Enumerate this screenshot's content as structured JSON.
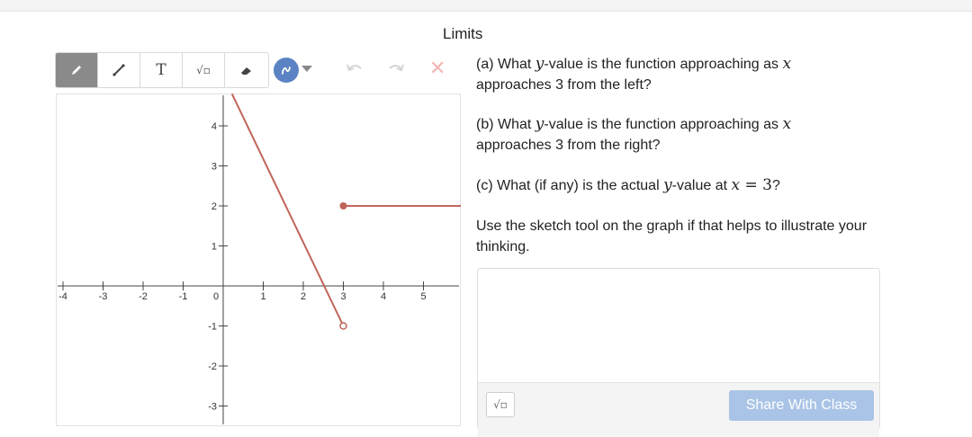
{
  "page": {
    "title": "Limits"
  },
  "toolbar": {
    "tools": [
      {
        "name": "pencil-icon",
        "active": true
      },
      {
        "name": "line-tool-icon",
        "active": false
      },
      {
        "name": "text-tool-icon",
        "label": "T",
        "active": false
      },
      {
        "name": "math-tool-icon",
        "label": "√▫",
        "active": false
      },
      {
        "name": "eraser-icon",
        "active": false
      }
    ],
    "color_button": {
      "color": "#5b83c4",
      "icon": "scribble-icon"
    },
    "undo_icon": "undo-icon",
    "redo_icon": "redo-icon",
    "clear_label": "✕"
  },
  "chart_data": {
    "type": "line",
    "x_ticks": [
      "-4",
      "-3",
      "-2",
      "-1",
      "0",
      "1",
      "2",
      "3",
      "4",
      "5"
    ],
    "y_ticks": [
      "4",
      "3",
      "2",
      "1",
      "-1",
      "-2",
      "-3"
    ],
    "xlim": [
      -4,
      6
    ],
    "ylim": [
      -3.5,
      4.8
    ],
    "series": [
      {
        "points": [
          [
            0.22,
            4.8
          ],
          [
            3,
            -1
          ]
        ],
        "color": "#c0655a",
        "end_marker": "open"
      },
      {
        "points": [
          [
            3,
            2
          ],
          [
            6,
            2
          ]
        ],
        "color": "#c0655a",
        "start_marker": "closed"
      }
    ]
  },
  "questions": {
    "a_prefix": "(a) What ",
    "a_var1": "y",
    "a_mid": "-value is the function approaching as ",
    "a_var2": "x",
    "a_line2": "approaches 3 from the left?",
    "b_prefix": "(b) What ",
    "b_var1": "y",
    "b_mid": "-value is the function approaching as ",
    "b_var2": "x",
    "b_line2": "approaches 3 from the right?",
    "c_prefix": "(c) What (if any) is the actual ",
    "c_var1": "y",
    "c_mid": "-value at ",
    "c_var2": "x",
    "c_eq": " = 3",
    "c_end": "?",
    "note": "Use the sketch tool on the graph if that helps to illustrate your thinking."
  },
  "answer": {
    "math_button_label": "√▫",
    "share_label": "Share With Class"
  }
}
